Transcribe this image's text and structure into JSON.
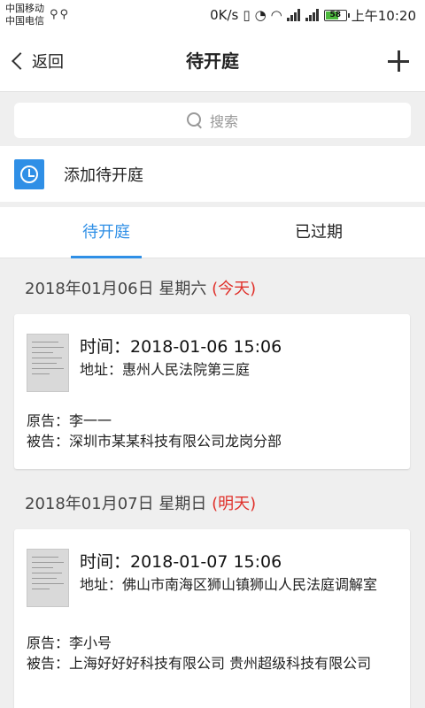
{
  "status_bar": {
    "carrier_1": "中国移动",
    "carrier_2": "中国电信",
    "net_speed": "0K/s",
    "battery": "58",
    "clock": "上午10:20"
  },
  "nav": {
    "back_label": "返回",
    "title": "待开庭"
  },
  "search": {
    "placeholder": "搜索"
  },
  "add_row": {
    "label": "添加待开庭"
  },
  "tabs": [
    {
      "label": "待开庭",
      "active": true
    },
    {
      "label": "已过期",
      "active": false
    }
  ],
  "groups": [
    {
      "date": "2018年01月06日 星期六",
      "relative": "(今天)",
      "card": {
        "time": "时间：2018-01-06 15:06",
        "address": "地址：惠州人民法院第三庭",
        "plaintiff": "原告：李一一",
        "defendant": "被告：深圳市某某科技有限公司龙岗分部"
      }
    },
    {
      "date": "2018年01月07日 星期日",
      "relative": "(明天)",
      "card": {
        "time": "时间：2018-01-07 15:06",
        "address": "地址：佛山市南海区狮山镇狮山人民法庭调解室",
        "plaintiff": "原告：李小号",
        "defendant": "被告：上海好好好科技有限公司 贵州超级科技有限公司"
      }
    }
  ],
  "colors": {
    "accent": "#2f8fe6",
    "relative_date": "#e0302a"
  }
}
